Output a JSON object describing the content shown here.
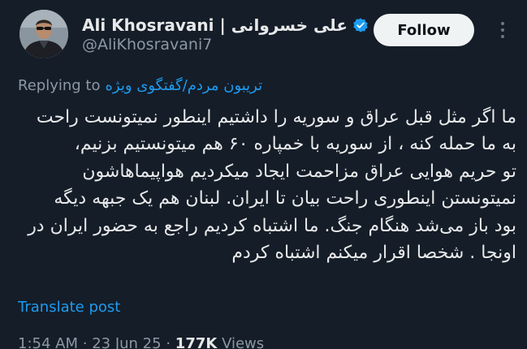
{
  "author": {
    "display_name": "Ali Khosravani | علی خسروانی",
    "handle": "@AliKhosravani7",
    "avatar_icon": "profile-photo",
    "verified_icon": "verified-badge-icon",
    "verified_color": "#1d9bf0"
  },
  "actions": {
    "follow_label": "Follow",
    "more_icon": "more-vertical-icon"
  },
  "reply": {
    "prefix": "Replying to",
    "target": "تریبون مردم/گفتگوی ویژه"
  },
  "tweet": {
    "lines": [
      "ما اگر مثل قبل عراق و سوریه را داشتیم اینطور نمیتونست راحت",
      "به ما حمله کنه ، از سوریه با خمپاره ۶۰ هم میتونستیم بزنیم،",
      "تو حریم هوایی عراق مزاحمت ایجاد میکردیم هواپیماهاشون",
      "نمیتونستن اینطوری راحت بیان تا ایران. لبنان هم یک جبهه دیگه",
      "بود باز می‌شد هنگام جنگ. ما اشتباه کردیم راجع به حضور ایران در",
      "اونجا . شخصا اقرار میکنم اشتباه کردم"
    ]
  },
  "translate_label": "Translate post",
  "meta": {
    "time": "1:54 AM",
    "date": "23 Jun 25",
    "views_count": "177K",
    "views_label": "Views",
    "separator": "·"
  },
  "colors": {
    "background": "#151d28",
    "text": "#e7e9ea",
    "muted": "#8b98a5",
    "accent": "#1d9bf0"
  }
}
